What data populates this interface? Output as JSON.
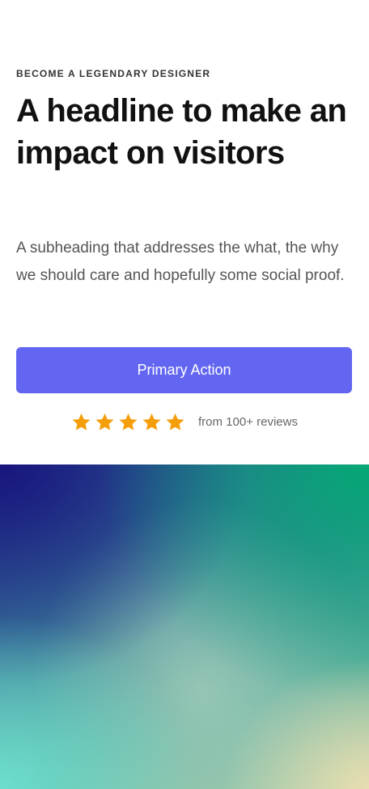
{
  "hero": {
    "eyebrow": "BECOME A LEGENDARY DESIGNER",
    "headline": "A headline to make an impact on visitors",
    "subheading": "A subheading that addresses the what, the why we should care and hopefully some social proof.",
    "primary_action_label": "Primary Action"
  },
  "rating": {
    "stars": 5,
    "max_stars": 5,
    "review_text": "from 100+ reviews"
  },
  "colors": {
    "accent": "#6366f1",
    "star": "#f59e0b",
    "text_primary": "#111111",
    "text_secondary": "#555555"
  },
  "icons": {
    "star": "star-icon"
  }
}
